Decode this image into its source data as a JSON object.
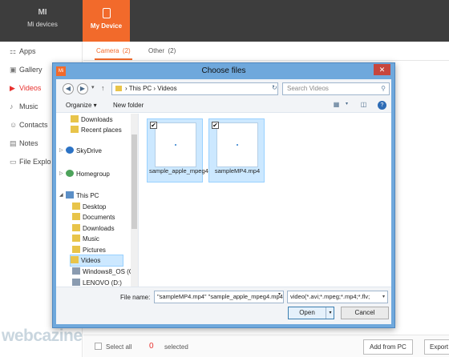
{
  "app": {
    "topnav": [
      {
        "icon": "mi-logo-icon",
        "icon_text": "MI",
        "label": "Mi devices"
      },
      {
        "icon": "phone-icon",
        "label": "My Device"
      }
    ],
    "sidebar": [
      {
        "icon": "apps-icon",
        "label": "Apps"
      },
      {
        "icon": "gallery-icon",
        "label": "Gallery"
      },
      {
        "icon": "video-icon",
        "label": "Videos"
      },
      {
        "icon": "music-icon",
        "label": "Music"
      },
      {
        "icon": "contacts-icon",
        "label": "Contacts"
      },
      {
        "icon": "notes-icon",
        "label": "Notes"
      },
      {
        "icon": "file-explorer-icon",
        "label": "File Explo"
      }
    ],
    "tabs": [
      {
        "label": "Camera",
        "count": "(2)"
      },
      {
        "label": "Other",
        "count": "(2)"
      }
    ],
    "bottom": {
      "select_all": "Select all",
      "count": "0",
      "selected": "selected",
      "add_from_pc": "Add from PC",
      "export": "Export"
    },
    "accent_color": "#f26a2b"
  },
  "dialog": {
    "title": "Choose files",
    "app_icon_text": "Mi",
    "close_symbol": "✕",
    "address": "This PC  ›  Videos",
    "address_prefix": "›",
    "search_placeholder": "Search Videos",
    "organize": "Organize ▾",
    "new_folder": "New folder",
    "tree": [
      {
        "label": "Downloads",
        "icon": "folder-icon"
      },
      {
        "label": "Recent places",
        "icon": "folder-icon"
      },
      {
        "label": "SkyDrive",
        "icon": "cloud-icon"
      },
      {
        "label": "Homegroup",
        "icon": "homegroup-icon"
      },
      {
        "label": "This PC",
        "icon": "pc-icon"
      },
      {
        "label": "Desktop",
        "icon": "folder-icon"
      },
      {
        "label": "Documents",
        "icon": "folder-icon"
      },
      {
        "label": "Downloads",
        "icon": "folder-icon"
      },
      {
        "label": "Music",
        "icon": "folder-icon"
      },
      {
        "label": "Pictures",
        "icon": "folder-icon"
      },
      {
        "label": "Videos",
        "icon": "folder-icon",
        "selected": true
      },
      {
        "label": "Windows8_OS (C",
        "icon": "drive-icon"
      },
      {
        "label": "LENOVO (D:)",
        "icon": "drive-icon"
      }
    ],
    "files": [
      {
        "name": "sample_apple_mpeg4.mp4",
        "checked": "✔"
      },
      {
        "name": "sampleMP4.mp4",
        "checked": "✔"
      }
    ],
    "file_name_label": "File name:",
    "file_name_value": "\"sampleMP4.mp4\" \"sample_apple_mpeg4.mp4\"",
    "file_type": "video(*.avi;*.mpeg;*.mp4;*.flv;",
    "open": "Open",
    "cancel": "Cancel"
  },
  "watermark": "webcazine"
}
